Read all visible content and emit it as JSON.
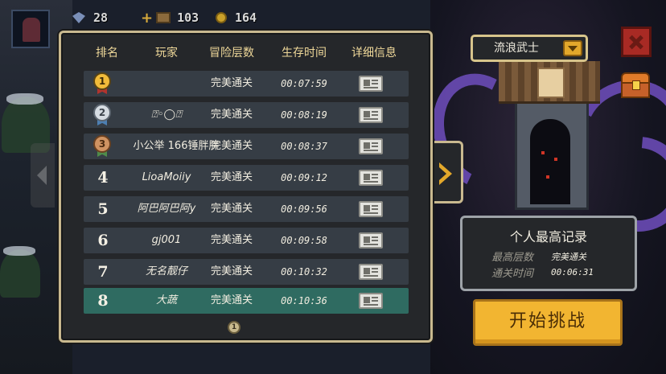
{
  "hud": {
    "gems": "28",
    "coins": "103",
    "materials": "164"
  },
  "leaderboard": {
    "headers": {
      "rank": "排名",
      "player": "玩家",
      "floors": "冒险层数",
      "time": "生存时间",
      "details": "详细信息"
    },
    "rows": [
      {
        "rank": "1",
        "player": "",
        "floors": "完美通关",
        "time": "00:07:59"
      },
      {
        "rank": "2",
        "player": "⍰◦◯⍰",
        "floors": "完美通关",
        "time": "00:08:19"
      },
      {
        "rank": "3",
        "player": "小公举 166锤胖胖",
        "floors": "完美通关",
        "time": "00:08:37"
      },
      {
        "rank": "4",
        "player": "LioaMoiiy",
        "floors": "完美通关",
        "time": "00:09:12"
      },
      {
        "rank": "5",
        "player": "阿巴阿巴阿y",
        "floors": "完美通关",
        "time": "00:09:56"
      },
      {
        "rank": "6",
        "player": "gj001",
        "floors": "完美通关",
        "time": "00:09:58"
      },
      {
        "rank": "7",
        "player": "无名靓仔",
        "floors": "完美通关",
        "time": "00:10:32"
      },
      {
        "rank": "8",
        "player": "大蔬",
        "floors": "完美通关",
        "time": "00:10:36"
      }
    ],
    "page": "1"
  },
  "class_select": {
    "selected": "流浪武士"
  },
  "personal_record": {
    "title": "个人最高记录",
    "floor_label": "最高层数",
    "floor_value": "完美通关",
    "time_label": "通关时间",
    "time_value": "00:06:31"
  },
  "start_button": "开始挑战",
  "colors": {
    "panel_border": "#c9b98f",
    "header_text": "#f0d99a",
    "row_bg": "#363d45",
    "highlight_row": "#2f6b61",
    "start_button": "#f2b531",
    "close_button": "#a82a24"
  }
}
